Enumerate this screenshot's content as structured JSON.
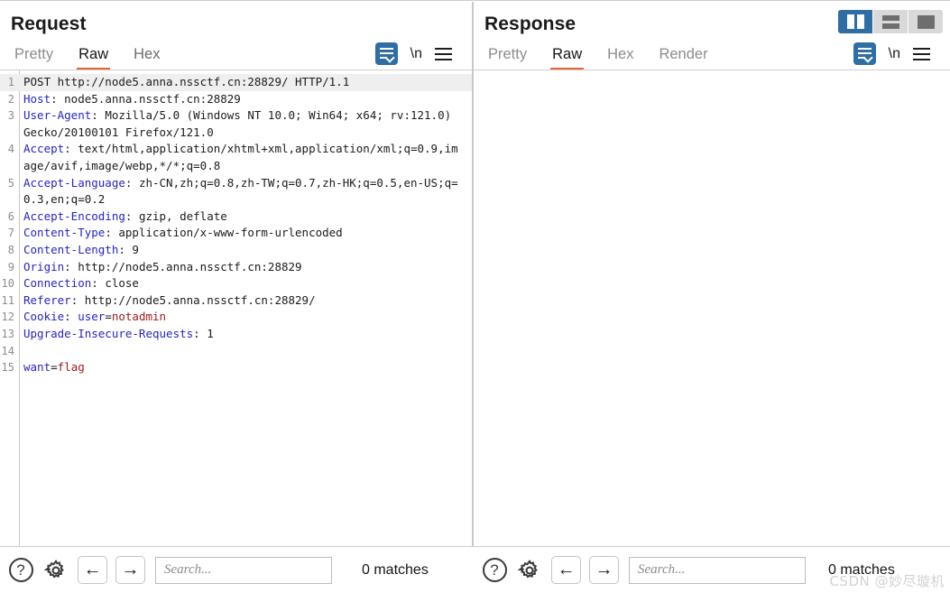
{
  "layout_toggle": {
    "buttons": [
      {
        "name": "vertical-split",
        "active": true
      },
      {
        "name": "horizontal-split",
        "active": false
      },
      {
        "name": "single-pane",
        "active": false
      }
    ]
  },
  "request": {
    "title": "Request",
    "tabs": [
      {
        "label": "Pretty",
        "active": false
      },
      {
        "label": "Raw",
        "active": true
      },
      {
        "label": "Hex",
        "active": false
      }
    ],
    "actions": {
      "wrap_label": "word-wrap",
      "newline_label": "\\n",
      "menu_label": "menu"
    },
    "lines": [
      {
        "n": "1",
        "highlight": true,
        "parts": [
          {
            "t": "POST http://node5.anna.nssctf.cn:28829/ HTTP/1.1",
            "c": "v"
          }
        ]
      },
      {
        "n": "2",
        "parts": [
          {
            "t": "Host",
            "c": "k"
          },
          {
            "t": ": node5.anna.nssctf.cn:28829",
            "c": "v"
          }
        ]
      },
      {
        "n": "3",
        "parts": [
          {
            "t": "User-Agent",
            "c": "k"
          },
          {
            "t": ": Mozilla/5.0 (Windows NT 10.0; Win64; x64; rv:121.0) Gecko/20100101 Firefox/121.0",
            "c": "v"
          }
        ]
      },
      {
        "n": "4",
        "parts": [
          {
            "t": "Accept",
            "c": "k"
          },
          {
            "t": ": text/html,application/xhtml+xml,application/xml;q=0.9,image/avif,image/webp,*/*;q=0.8",
            "c": "v"
          }
        ]
      },
      {
        "n": "5",
        "parts": [
          {
            "t": "Accept-Language",
            "c": "k"
          },
          {
            "t": ": zh-CN,zh;q=0.8,zh-TW;q=0.7,zh-HK;q=0.5,en-US;q=0.3,en;q=0.2",
            "c": "v"
          }
        ]
      },
      {
        "n": "6",
        "parts": [
          {
            "t": "Accept-Encoding",
            "c": "k"
          },
          {
            "t": ": gzip, deflate",
            "c": "v"
          }
        ]
      },
      {
        "n": "7",
        "parts": [
          {
            "t": "Content-Type",
            "c": "k"
          },
          {
            "t": ": application/x-www-form-urlencoded",
            "c": "v"
          }
        ]
      },
      {
        "n": "8",
        "parts": [
          {
            "t": "Content-Length",
            "c": "k"
          },
          {
            "t": ": 9",
            "c": "v"
          }
        ]
      },
      {
        "n": "9",
        "parts": [
          {
            "t": "Origin",
            "c": "k"
          },
          {
            "t": ": http://node5.anna.nssctf.cn:28829",
            "c": "v"
          }
        ]
      },
      {
        "n": "10",
        "parts": [
          {
            "t": "Connection",
            "c": "k"
          },
          {
            "t": ": close",
            "c": "v"
          }
        ]
      },
      {
        "n": "11",
        "parts": [
          {
            "t": "Referer",
            "c": "k"
          },
          {
            "t": ": http://node5.anna.nssctf.cn:28829/",
            "c": "v"
          }
        ]
      },
      {
        "n": "12",
        "parts": [
          {
            "t": "Cookie",
            "c": "k"
          },
          {
            "t": ": ",
            "c": "v"
          },
          {
            "t": "user",
            "c": "bl"
          },
          {
            "t": "=",
            "c": "v"
          },
          {
            "t": "notadmin",
            "c": "rd"
          }
        ]
      },
      {
        "n": "13",
        "parts": [
          {
            "t": "Upgrade-Insecure-Requests",
            "c": "k"
          },
          {
            "t": ": 1",
            "c": "v"
          }
        ]
      },
      {
        "n": "14",
        "parts": [
          {
            "t": "",
            "c": "v"
          }
        ]
      },
      {
        "n": "15",
        "parts": [
          {
            "t": "want",
            "c": "bl"
          },
          {
            "t": "=",
            "c": "v"
          },
          {
            "t": "flag",
            "c": "rd"
          }
        ]
      }
    ],
    "toolbar": {
      "help_label": "?",
      "settings_label": "settings",
      "prev_label": "←",
      "next_label": "→",
      "search_value": "",
      "search_placeholder": "Search...",
      "matches": "0 matches"
    }
  },
  "response": {
    "title": "Response",
    "tabs": [
      {
        "label": "Pretty",
        "active": false
      },
      {
        "label": "Raw",
        "active": true
      },
      {
        "label": "Hex",
        "active": false
      },
      {
        "label": "Render",
        "active": false
      }
    ],
    "actions": {
      "wrap_label": "word-wrap",
      "newline_label": "\\n",
      "menu_label": "menu"
    },
    "lines": [],
    "toolbar": {
      "help_label": "?",
      "settings_label": "settings",
      "prev_label": "←",
      "next_label": "→",
      "search_value": "",
      "search_placeholder": "Search...",
      "matches": "0 matches"
    }
  },
  "watermark": "CSDN @妙尽璇机",
  "colors": {
    "accent_blue": "#2f6da5",
    "tab_underline": "#e8643c",
    "header_key": "#2424c8",
    "value_red": "#9e1a1a"
  }
}
